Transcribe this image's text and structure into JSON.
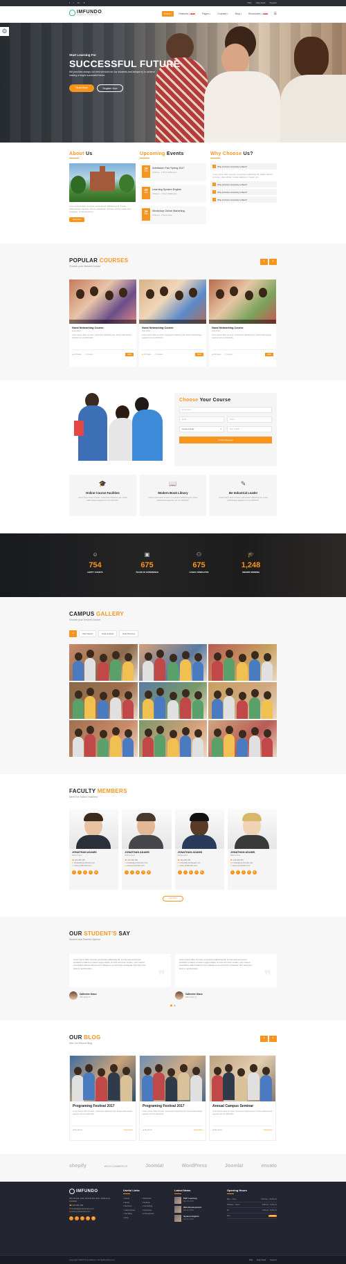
{
  "topbar": {
    "social": [
      "f",
      "t",
      "G+",
      "in"
    ],
    "links": [
      "FAQ",
      "Help Desk",
      "Support"
    ]
  },
  "header": {
    "logo": "IMFUNDO",
    "tagline": "EDUCATION & COURSE THEME",
    "nav": [
      {
        "label": "Home",
        "badge": ""
      },
      {
        "label": "Features",
        "badge": "NEW"
      },
      {
        "label": "Pages",
        "badge": ""
      },
      {
        "label": "Courses",
        "badge": ""
      },
      {
        "label": "Blog",
        "badge": ""
      },
      {
        "label": "Shortcodes",
        "badge": "NEW"
      }
    ]
  },
  "hero": {
    "kicker": "Start Learning For",
    "title": "SUCCESSFUL FUTURE",
    "text": "We provides always our best services for our students and always try to achieve making a bright successful future.",
    "btn1": "Read More",
    "btn2": "Register Now"
  },
  "about": {
    "title_a": "About",
    "title_b": "Us",
    "text": "Lorem ipsum dolor sit amet, consectetur adipiscing elit. Fusce pellentesque egestas nisl vel sollicitudin. Aenean ornare mattis sem vulputate, ut feugiat lorem.",
    "btn": "Read More"
  },
  "events": {
    "title_a": "Upcoming",
    "title_b": "Events",
    "items": [
      {
        "day": "28",
        "mon": "FEB",
        "title": "Admission Fair Spring 2017",
        "meta": "07:00 pm - 7:30 pm  Melbourne"
      },
      {
        "day": "28",
        "mon": "FEB",
        "title": "Learning Spoken English",
        "meta": "07:00 pm - 7:30 pm  Melbourne"
      },
      {
        "day": "28",
        "mon": "FEB",
        "title": "Workshop Online Marketing",
        "meta": "07:00 pm - 7:30 pm  USA"
      }
    ]
  },
  "why": {
    "title_a": "Why Choose",
    "title_b": "Us?",
    "items": [
      "Why Imfundo University is Best?",
      "Why Imfundo University is Best?",
      "Why Imfundo University is Best?",
      "Why Imfundo University is Best?"
    ],
    "text": "Lorem ipsum dolor sit amet, consectetur adipiscing elit. Nullam dictum porta leo, vitae efficitur massa dapibus et. Integer non."
  },
  "courses": {
    "title_a": "POPULAR",
    "title_b": "COURSES",
    "sub": "Choose your Desired Course",
    "items": [
      {
        "name": "Nural Networking Course",
        "author": "Jack Hobs",
        "text": "Lorem ipsum dolor sit amet, consectetur adipiscing elit. Fusce pellentesque egestas nisl vel sollicitudin.",
        "students": "34 Seats",
        "hours": "5 Hours",
        "price": "$400"
      },
      {
        "name": "Nural Networking Course",
        "author": "Jack Hobs",
        "text": "Lorem ipsum dolor sit amet, consectetur adipiscing elit. Fusce pellentesque egestas nisl vel sollicitudin.",
        "students": "34 Seats",
        "hours": "5 Hours",
        "price": "$400"
      },
      {
        "name": "Nural Networking Course",
        "author": "Jack Hobs",
        "text": "Lorem ipsum dolor sit amet, consectetur adipiscing elit. Fusce pellentesque egestas nisl vel sollicitudin.",
        "students": "34 Seats",
        "hours": "5 Hours",
        "price": "$400"
      }
    ]
  },
  "choose": {
    "title_a": "Choose",
    "title_b": "Your Course",
    "name_ph": "Enter Name",
    "email_ph": "Email",
    "phone_ph": "Phone",
    "faculty": "Choose Faculty",
    "dob_ph": "Date of Birth",
    "btn": "Submit Request"
  },
  "features": [
    {
      "title": "Online Course Facilities",
      "text": "Lorem ipsum dolor sit amet, consectetur adipiscing elit. Fusce pellentesque egestas nisl vel sollicitudin."
    },
    {
      "title": "Modern Book Library",
      "text": "Lorem ipsum dolor sit amet, consectetur adipiscing elit. Fusce pellentesque egestas nisl vel sollicitudin."
    },
    {
      "title": "Be Industrial Leader",
      "text": "Lorem ipsum dolor sit amet, consectetur adipiscing elit. Fusce pellentesque egestas nisl vel sollicitudin."
    }
  ],
  "counters": [
    {
      "num": "754",
      "label": "HAPPY CLIENTS"
    },
    {
      "num": "675",
      "label": "YEARS OF EXPERIENCE"
    },
    {
      "num": "675",
      "label": "CASES COMPLETED"
    },
    {
      "num": "1,248",
      "label": "AWARDS WINNING"
    }
  ],
  "gallery": {
    "title_a": "CAMPUS",
    "title_b": "GALLERY",
    "sub": "Choose your Desired Course",
    "filters": [
      "All",
      "Web Design",
      "Data Analysis",
      "Data Structure"
    ]
  },
  "faculty": {
    "title_a": "FACULTY",
    "title_b": "MEMBERS",
    "sub": "Meet Our Skilled Teachers",
    "members": [
      {
        "name": "JONATHAN ADAMS",
        "dept": "Mathematics",
        "phone": "123-456-789",
        "email": "contact@yourdomain.com",
        "web": "www.yourdomain.com"
      },
      {
        "name": "JONATHAN ADAMS",
        "dept": "Mathematics",
        "phone": "123-456-789",
        "email": "contact@yourdomain.com",
        "web": "www.yourdomain.com"
      },
      {
        "name": "JONATHAN ADAMS",
        "dept": "Mathematics",
        "phone": "123-456-789",
        "email": "contact@yourdomain.com",
        "web": "www.yourdomain.com"
      },
      {
        "name": "JONATHAN ADAMS",
        "dept": "Mathematics",
        "phone": "123-456-789",
        "email": "contact@yourdomain.com",
        "web": "www.yourdomain.com"
      }
    ],
    "btn": "Load More"
  },
  "testimonials": {
    "title_a": "OUR",
    "title_b": "STUDENT'S",
    "title_c": "SAY",
    "sub": "Student and Parents Opinion",
    "items": [
      {
        "text": "Lorem ipsum dolor sit amet, consectetur adipiscing elit, sed do eiusmod tempor incididunt ut labore et dolore magna aliqua. Ut enim ad minim veniam, quis nostrud exercitation ullamco laboris nisi ut aliquip ex ea commodo consequat. Duis aute irure dolor in reprehenderit.",
        "name": "Catherine Grace",
        "role": "CEO apple inc"
      },
      {
        "text": "Lorem ipsum dolor sit amet, consectetur adipiscing elit, sed do eiusmod tempor incididunt ut labore et dolore magna aliqua. Ut enim ad minim veniam, quis nostrud exercitation ullamco laboris nisi ut aliquip ex ea commodo consequat. Duis aute irure dolor in reprehenderit.",
        "name": "Catherine Grace",
        "role": "CEO apple inc"
      }
    ]
  },
  "blog": {
    "title_a": "OUR",
    "title_b": "BLOG",
    "sub": "See Our Recent Blog",
    "posts": [
      {
        "title": "Programing Festival 2017",
        "text": "Lorem ipsum dolor sit amet, consectetur adipiscing elit. Fusce pellentesque egestas nisl vel sollicitudin.",
        "author": "By admin",
        "more": "Read More"
      },
      {
        "title": "Programing Festival 2017",
        "text": "Lorem ipsum dolor sit amet, consectetur adipiscing elit. Fusce pellentesque egestas nisl vel sollicitudin.",
        "author": "By admin",
        "more": "Read More"
      },
      {
        "title": "Annual Campus Seminar",
        "text": "Lorem ipsum dolor sit amet, consectetur adipiscing elit. Fusce pellentesque egestas nisl vel sollicitudin.",
        "author": "By admin",
        "more": "Read More"
      }
    ]
  },
  "partners": [
    "shopify",
    "WOOCOMMERCE",
    "Joomla!",
    "WordPress",
    "Joomla!",
    "envato"
  ],
  "footer": {
    "logo": "IMFUNDO",
    "address": "203, Envato Labs, Behind Alis Steet, Melbourne, Australia.",
    "phone": "123-456-789",
    "email": "contact@yourdomain.com",
    "web": "www.yourdomain.com",
    "links_title": "Useful Links",
    "links_a": [
      "Home",
      "About",
      "Services",
      "Latest News",
      "Our Blog",
      "FAQ"
    ],
    "links_b": [
      "Business",
      "Finance",
      "Consulting",
      "Insurance",
      "Professional"
    ],
    "news_title": "Latest News",
    "news": [
      {
        "title": "PHP Learning",
        "date": "Mar 28, 2015"
      },
      {
        "title": "Web Development",
        "date": "Mar 28, 2015"
      },
      {
        "title": "Spoken English",
        "date": "Mar 28, 2015"
      }
    ],
    "hours_title": "Opening Hours",
    "hours": [
      {
        "day": "Mon - Tues :",
        "time": "6.00 am - 10.00 pm"
      },
      {
        "day": "Wednes - Thurs :",
        "time": "8.00 am - 6.00 pm"
      },
      {
        "day": "Fri :",
        "time": "3.00 pm - 8.00 pm"
      },
      {
        "day": "Sun :",
        "time": "Closed"
      }
    ],
    "copyright": "Copyright ©2018 ThemeMascot. All Rights Reserved",
    "bottom_links": [
      "FAQ",
      "Help Desk",
      "Support"
    ]
  },
  "colors": {
    "accent": "#f7941d",
    "dark": "#232530",
    "light": "#f7f7f7"
  }
}
